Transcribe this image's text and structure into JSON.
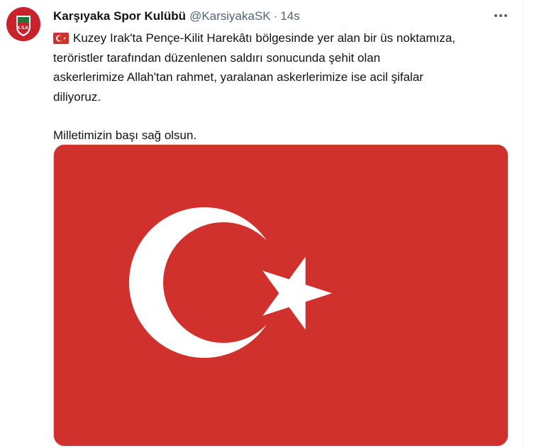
{
  "tweet": {
    "display_name": "Karşıyaka Spor Kulübü",
    "handle": "@KarsiyakaSK",
    "separator": "·",
    "timestamp": "14s",
    "text_line_1": "Kuzey Irak'ta Pençe-Kilit Harekâtı bölgesinde yer alan bir üs noktamıza,",
    "text_line_2": "teröristler tarafından düzenlenen saldırı sonucunda şehit olan",
    "text_line_3": "askerlerimize Allah'tan rahmet, yaralanan askerlerimize ise acil şifalar",
    "text_line_4": "diliyoruz.",
    "text_line_5": "Milletimizin başı sağ olsun."
  },
  "avatar": {
    "logo_text": "K.S.K."
  },
  "icons": {
    "more": "more-options-icon",
    "flag": "turkey-flag-icon"
  },
  "colors": {
    "flag_red": "#d0312d",
    "club_red": "#c8232c",
    "club_green": "#1a7a3a",
    "text_primary": "#0f1419",
    "text_secondary": "#536471"
  }
}
